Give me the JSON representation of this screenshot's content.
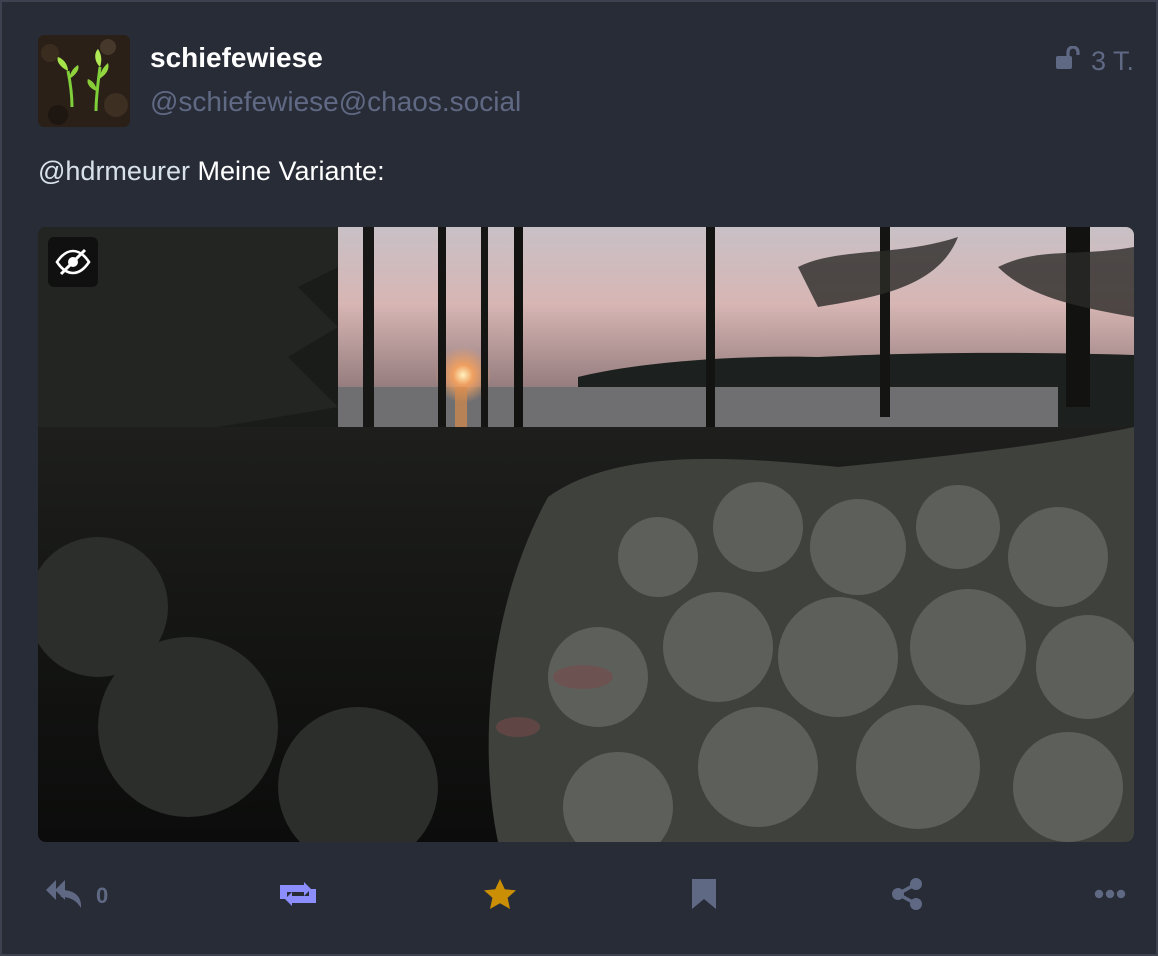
{
  "account": {
    "display_name": "schiefewiese",
    "handle": "@schiefewiese@chaos.social"
  },
  "status": {
    "visibility_icon": "unlock-icon",
    "relative_time": "3 T.",
    "mention": "@hdrmeurer",
    "text": " Meine Variante:"
  },
  "media": {
    "toggle_icon": "eye-slash-icon"
  },
  "actions": {
    "reply_count": "0",
    "reply_icon": "reply-all-icon",
    "boost_icon": "retweet-icon",
    "favourite_icon": "star-icon",
    "bookmark_icon": "bookmark-icon",
    "share_icon": "share-icon",
    "more_icon": "ellipsis-icon"
  },
  "colors": {
    "background": "#282c37",
    "secondary_text": "#606984",
    "boost_active": "#8c8dff",
    "favourite_active": "#ca8f04"
  }
}
